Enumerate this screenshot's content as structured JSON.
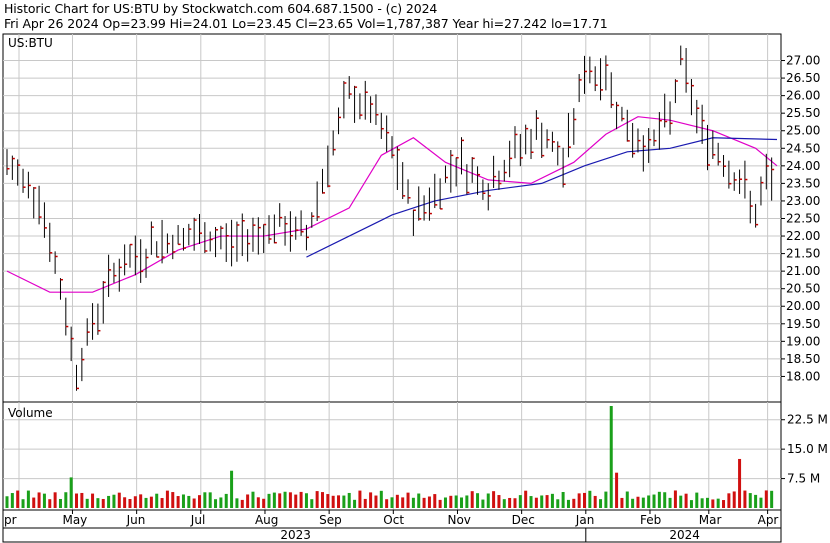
{
  "header": {
    "line1": "Historic Chart for US:BTU by Stockwatch.com 604.687.1500 - (c) 2024",
    "line2": "Fri Apr 26 2024   Op=23.99  Hi=24.01  Lo=23.45  Cl=23.65  Vol=1,787,387  Year hi=27.242  lo=17.71"
  },
  "colors": {
    "price_bar": "#000000",
    "close_tick": "#c00000",
    "ma_short": "#e000c8",
    "ma_long": "#1a1ab0",
    "vol_up": "#1aa01a",
    "vol_down": "#d01010",
    "grid": "#c8c8c8"
  },
  "chart_data": [
    {
      "type": "ohlc",
      "title": "US:BTU",
      "ylim": [
        17.5,
        27.3
      ],
      "y_ticks": [
        "27.00",
        "26.50",
        "26.00",
        "25.50",
        "25.00",
        "24.50",
        "24.00",
        "23.50",
        "23.00",
        "22.50",
        "22.00",
        "21.50",
        "21.00",
        "20.50",
        "20.00",
        "19.50",
        "19.00",
        "18.50",
        "18.00"
      ],
      "series": [
        {
          "name": "short-ma",
          "points": [
            [
              0,
              21.0
            ],
            [
              8,
              20.4
            ],
            [
              16,
              20.4
            ],
            [
              24,
              20.9
            ],
            [
              32,
              21.6
            ],
            [
              40,
              22.0
            ],
            [
              48,
              22.0
            ],
            [
              56,
              22.2
            ],
            [
              64,
              22.8
            ],
            [
              70,
              24.3
            ],
            [
              76,
              24.8
            ],
            [
              82,
              24.1
            ],
            [
              90,
              23.6
            ],
            [
              98,
              23.5
            ],
            [
              106,
              24.1
            ],
            [
              112,
              24.9
            ],
            [
              118,
              25.4
            ],
            [
              124,
              25.3
            ],
            [
              132,
              25.0
            ],
            [
              140,
              24.5
            ],
            [
              144,
              24.0
            ]
          ]
        },
        {
          "name": "long-ma",
          "points": [
            [
              56,
              21.4
            ],
            [
              64,
              22.0
            ],
            [
              72,
              22.6
            ],
            [
              80,
              23.0
            ],
            [
              90,
              23.3
            ],
            [
              100,
              23.5
            ],
            [
              108,
              24.0
            ],
            [
              116,
              24.4
            ],
            [
              124,
              24.5
            ],
            [
              132,
              24.8
            ],
            [
              144,
              24.75
            ]
          ]
        }
      ],
      "volume": {
        "label": "Volume",
        "ticks": [
          "22.5 M",
          "15.0 M",
          "7.5 M"
        ],
        "ylim": [
          0,
          26
        ]
      },
      "x_months": [
        "pr",
        "May",
        "Jun",
        "Jul",
        "Aug",
        "Sep",
        "Oct",
        "Nov",
        "Dec",
        "Jan",
        "Feb",
        "Mar",
        "Apr"
      ],
      "x_years": [
        "2023",
        "2024"
      ]
    }
  ]
}
